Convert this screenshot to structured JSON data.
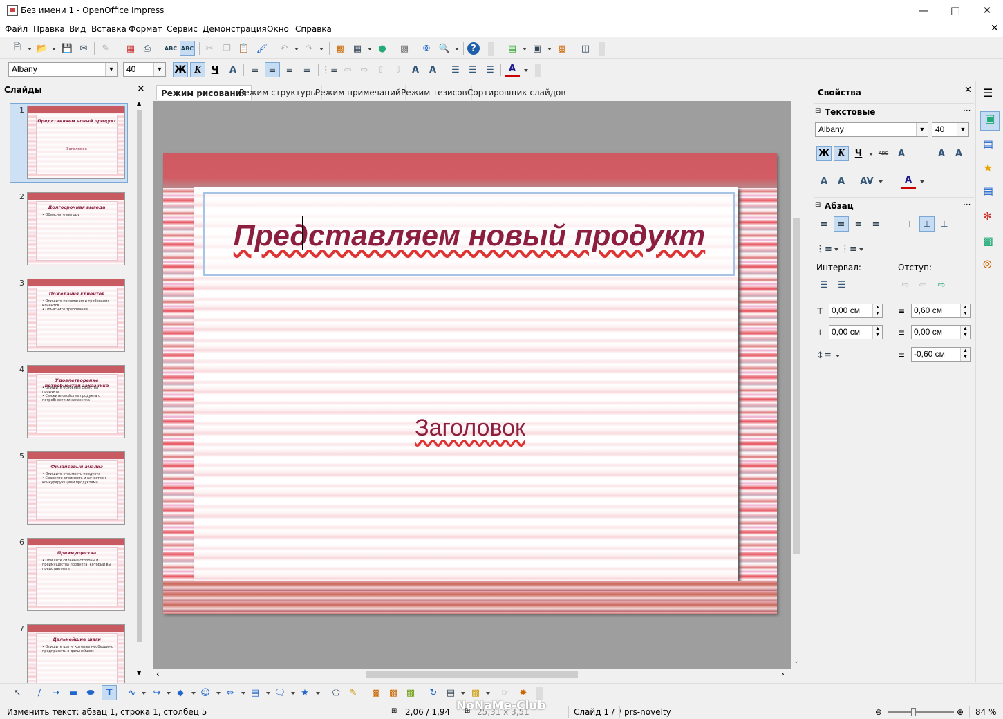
{
  "window": {
    "title": "Без имени 1 - OpenOffice Impress",
    "minimize_icon": "minimize-icon",
    "maximize_icon": "maximize-icon",
    "close_icon": "close-icon"
  },
  "menubar": {
    "items": [
      "Файл",
      "Правка",
      "Вид",
      "Вставка",
      "Формат",
      "Сервис",
      "Демонстрация",
      "Окно",
      "Справка"
    ]
  },
  "format_toolbar": {
    "font_name": "Albany",
    "font_size": "40",
    "bold_label": "Ж",
    "italic_label": "К",
    "underline_label": "Ч"
  },
  "slides_panel": {
    "title": "Слайды",
    "slides": [
      {
        "number": "1",
        "title": "Представляем новый продукт",
        "subtitle": "Заголовок",
        "bullets": []
      },
      {
        "number": "2",
        "title": "Долгосрочная выгода",
        "subtitle": "",
        "bullets": [
          "Объясните выгоду"
        ]
      },
      {
        "number": "3",
        "title": "Пожелания клиентов",
        "subtitle": "",
        "bullets": [
          "Опишите пожелания и требования клиентов",
          "Объясните требования"
        ]
      },
      {
        "number": "4",
        "title": "Удовлетворение потребностей заказчика",
        "subtitle": "",
        "bullets": [
          "Опишите основные свойства продукта",
          "Свяжите свойства продукта с потребностями заказчика"
        ]
      },
      {
        "number": "5",
        "title": "Финансовый анализ",
        "subtitle": "",
        "bullets": [
          "Опишите стоимость продукта",
          "Сравните стоимость и качество с конкурирующими продуктами"
        ]
      },
      {
        "number": "6",
        "title": "Преимущества",
        "subtitle": "",
        "bullets": [
          "Опишите сильные стороны и преимущества продукта, который вы представляете"
        ]
      },
      {
        "number": "7",
        "title": "Дальнейшие шаги",
        "subtitle": "",
        "bullets": [
          "Опишите шаги, которые необходимо предпринять в дальнейшем"
        ]
      }
    ]
  },
  "view_tabs": [
    "Режим рисования",
    "Режим структуры",
    "Режим примечаний",
    "Режим тезисов",
    "Сортировщик слайдов"
  ],
  "active_tab": "Режим рисования",
  "slide": {
    "title": "Представляем новый продукт",
    "subtitle": "Заголовок"
  },
  "sidebar": {
    "title": "Свойства",
    "text_section": "Текстовые",
    "font_name": "Albany",
    "font_size": "40",
    "bold_label": "Ж",
    "italic_label": "К",
    "underline_label": "Ч",
    "strike_label": "ABC",
    "paragraph_section": "Абзац",
    "spacing_label": "Интервал:",
    "indent_label": "Отступ:",
    "spacing_above": "0,00 см",
    "spacing_below": "0,00 см",
    "indent_before": "0,60 см",
    "indent_after": "0,00 см",
    "first_line": "-0,60 см"
  },
  "statusbar": {
    "edit_text": "Изменить текст: абзац 1, строка 1, столбец 5",
    "position": "2,06 / 1,94",
    "size": "25,31 x 3,51",
    "slide_info": "Слайд 1 / 7",
    "design": "prs-novelty",
    "zoom": "84 %"
  },
  "watermark": "NoNaMe-Club",
  "colors": {
    "accent": "#8c1e3e",
    "selection": "#c6dcf2",
    "band": "#cf5a62"
  }
}
